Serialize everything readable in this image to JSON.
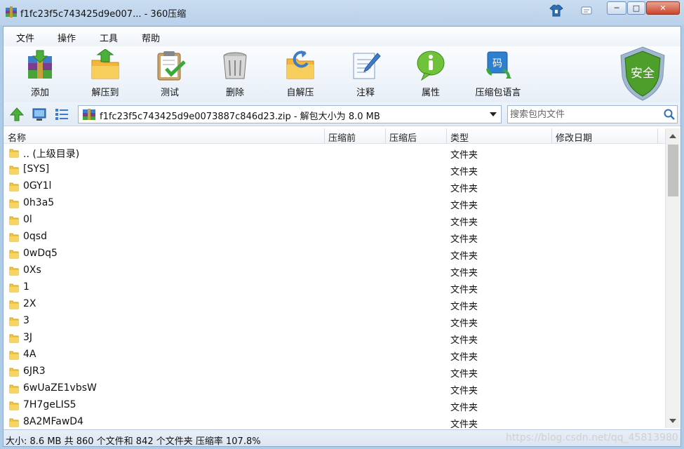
{
  "window": {
    "title": "f1fc23f5c743425d9e007... - 360压缩",
    "minimize_symbol": "─",
    "maximize_symbol": "□",
    "close_symbol": "✕"
  },
  "menu": [
    "文件",
    "操作",
    "工具",
    "帮助"
  ],
  "toolbar": [
    {
      "label": "添加",
      "icon": "add-archive-icon"
    },
    {
      "label": "解压到",
      "icon": "extract-folder-icon"
    },
    {
      "label": "测试",
      "icon": "test-clipboard-icon"
    },
    {
      "label": "删除",
      "icon": "trash-bin-icon"
    },
    {
      "label": "自解压",
      "icon": "self-extract-icon"
    },
    {
      "label": "注释",
      "icon": "comment-notepad-icon"
    },
    {
      "label": "属性",
      "icon": "info-properties-icon"
    },
    {
      "label": "压缩包语言",
      "icon": "language-code-icon"
    }
  ],
  "security_badge": "安全",
  "address": {
    "path": "f1fc23f5c743425d9e0073887c846d23.zip - 解包大小为 8.0 MB",
    "search_placeholder": "搜索包内文件"
  },
  "columns": [
    "名称",
    "压缩前",
    "压缩后",
    "类型",
    "修改日期"
  ],
  "rows": [
    {
      "name": ".. (上级目录)",
      "type": "文件夹"
    },
    {
      "name": "[SYS]",
      "type": "文件夹"
    },
    {
      "name": "0GY1l",
      "type": "文件夹"
    },
    {
      "name": "0h3a5",
      "type": "文件夹"
    },
    {
      "name": "0l",
      "type": "文件夹"
    },
    {
      "name": "0qsd",
      "type": "文件夹"
    },
    {
      "name": "0wDq5",
      "type": "文件夹"
    },
    {
      "name": "0Xs",
      "type": "文件夹"
    },
    {
      "name": "1",
      "type": "文件夹"
    },
    {
      "name": "2X",
      "type": "文件夹"
    },
    {
      "name": "3",
      "type": "文件夹"
    },
    {
      "name": "3J",
      "type": "文件夹"
    },
    {
      "name": "4A",
      "type": "文件夹"
    },
    {
      "name": "6JR3",
      "type": "文件夹"
    },
    {
      "name": "6wUaZE1vbsW",
      "type": "文件夹"
    },
    {
      "name": "7H7geLIS5",
      "type": "文件夹"
    },
    {
      "name": "8A2MFawD4",
      "type": "文件夹"
    }
  ],
  "status": "大小: 8.6 MB 共 860 个文件和 842 个文件夹 压缩率 107.8%",
  "watermark": "https://blog.csdn.net/qq_45813980",
  "colors": {
    "title_bar": "#b9d1ea",
    "close_button": "#c9452a",
    "folder": "#f2c641",
    "security_shield": "#4e9e2c"
  }
}
